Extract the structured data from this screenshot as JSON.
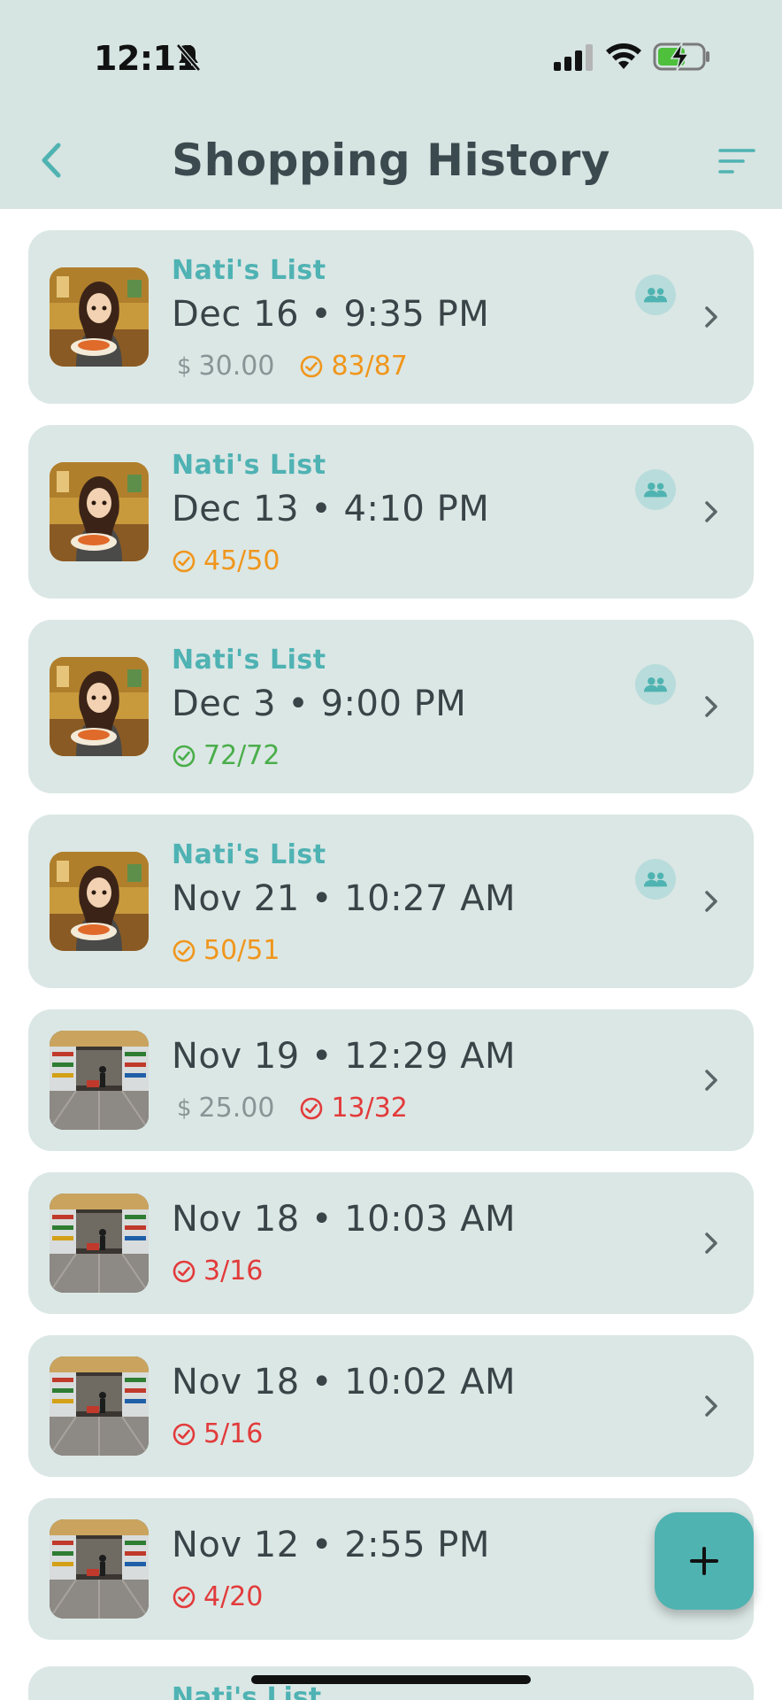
{
  "status_bar": {
    "time": "12:11"
  },
  "header": {
    "title": "Shopping History"
  },
  "colors": {
    "accent": "#4fb3b1",
    "card_bg": "#dbe7e5",
    "header_bg": "#d6e4e2",
    "partial": "#f0961c",
    "complete": "#4aae4a",
    "low": "#e23b3b"
  },
  "entries": [
    {
      "owner": "Nati's List",
      "datetime": "Dec 16 • 9:35 PM",
      "price": "30.00",
      "progress": "83/87",
      "status": "orange",
      "shared": true,
      "thumb": "person"
    },
    {
      "owner": "Nati's List",
      "datetime": "Dec 13 • 4:10 PM",
      "price": "",
      "progress": "45/50",
      "status": "orange",
      "shared": true,
      "thumb": "person"
    },
    {
      "owner": "Nati's List",
      "datetime": "Dec 3 • 9:00 PM",
      "price": "",
      "progress": "72/72",
      "status": "green",
      "shared": true,
      "thumb": "person"
    },
    {
      "owner": "Nati's List",
      "datetime": "Nov 21 • 10:27 AM",
      "price": "",
      "progress": "50/51",
      "status": "orange",
      "shared": true,
      "thumb": "person"
    },
    {
      "owner": "",
      "datetime": "Nov 19 • 12:29 AM",
      "price": "25.00",
      "progress": "13/32",
      "status": "red",
      "shared": false,
      "thumb": "store"
    },
    {
      "owner": "",
      "datetime": "Nov 18 • 10:03 AM",
      "price": "",
      "progress": "3/16",
      "status": "red",
      "shared": false,
      "thumb": "store"
    },
    {
      "owner": "",
      "datetime": "Nov 18 • 10:02 AM",
      "price": "",
      "progress": "5/16",
      "status": "red",
      "shared": false,
      "thumb": "store"
    },
    {
      "owner": "",
      "datetime": "Nov 12 • 2:55 PM",
      "price": "",
      "progress": "4/20",
      "status": "red",
      "shared": false,
      "thumb": "store"
    }
  ],
  "peek_owner": "Nati's List",
  "icons": {
    "back": "chevron-left-icon",
    "filter": "sort-icon",
    "shared": "group-icon",
    "add": "plus-icon"
  }
}
